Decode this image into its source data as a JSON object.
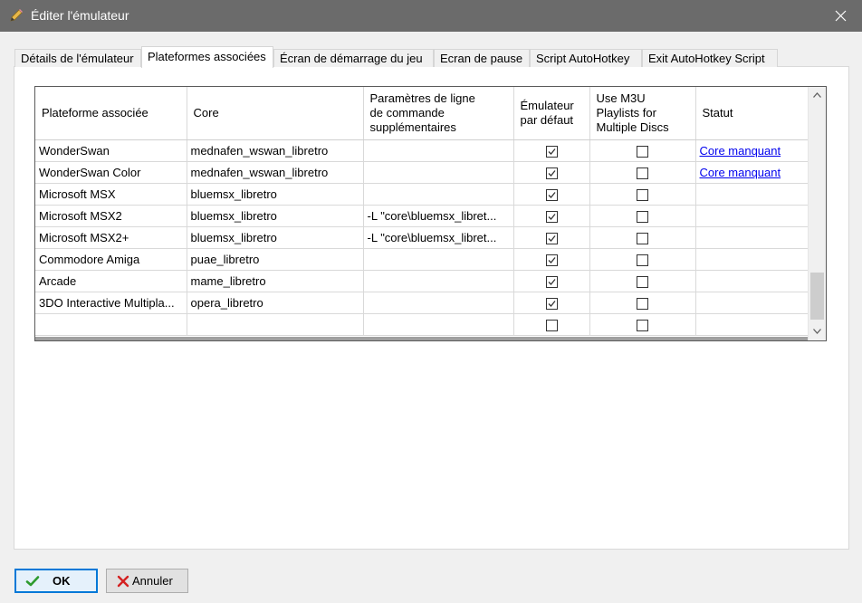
{
  "window": {
    "title": "Éditer l'émulateur"
  },
  "tabs": [
    {
      "label": "Détails de l'émulateur"
    },
    {
      "label": "Plateformes associées"
    },
    {
      "label": "Écran de démarrage du jeu"
    },
    {
      "label": "Ecran de pause"
    },
    {
      "label": "Script AutoHotkey"
    },
    {
      "label": "Exit AutoHotkey Script"
    }
  ],
  "active_tab": "Plateformes associées",
  "grid": {
    "headers": [
      "Plateforme associée",
      "Core",
      "Paramètres de ligne de commande supplémentaires",
      "Émulateur par défaut",
      "Use M3U Playlists for Multiple Discs",
      "Statut"
    ],
    "rows": [
      {
        "platform": "WonderSwan",
        "core": "mednafen_wswan_libretro",
        "params": "",
        "default": true,
        "m3u": false,
        "status": "Core manquant"
      },
      {
        "platform": "WonderSwan Color",
        "core": "mednafen_wswan_libretro",
        "params": "",
        "default": true,
        "m3u": false,
        "status": "Core manquant"
      },
      {
        "platform": "Microsoft MSX",
        "core": "bluemsx_libretro",
        "params": "",
        "default": true,
        "m3u": false,
        "status": ""
      },
      {
        "platform": "Microsoft MSX2",
        "core": "bluemsx_libretro",
        "params": "-L \"core\\bluemsx_libret...",
        "default": true,
        "m3u": false,
        "status": ""
      },
      {
        "platform": "Microsoft MSX2+",
        "core": "bluemsx_libretro",
        "params": "-L \"core\\bluemsx_libret...",
        "default": true,
        "m3u": false,
        "status": ""
      },
      {
        "platform": "Commodore Amiga",
        "core": "puae_libretro",
        "params": "",
        "default": true,
        "m3u": false,
        "status": ""
      },
      {
        "platform": "Arcade",
        "core": "mame_libretro",
        "params": "",
        "default": true,
        "m3u": false,
        "status": ""
      },
      {
        "platform": "3DO Interactive Multipla...",
        "core": "opera_libretro",
        "params": "",
        "default": true,
        "m3u": false,
        "status": ""
      },
      {
        "platform": "",
        "core": "",
        "params": "",
        "default": false,
        "m3u": false,
        "status": ""
      }
    ]
  },
  "buttons": {
    "ok_label": "OK",
    "cancel_label": "Annuler"
  },
  "icons": {
    "app": "pencil-icon",
    "close": "close-icon",
    "ok": "checkmark-icon",
    "cancel": "red-x-icon"
  },
  "colors": {
    "titlebar": "#6b6b6b",
    "link": "#0000ee",
    "ok_check": "#2e9b2e",
    "cancel_x": "#d42020",
    "focus_border": "#0078d7"
  }
}
